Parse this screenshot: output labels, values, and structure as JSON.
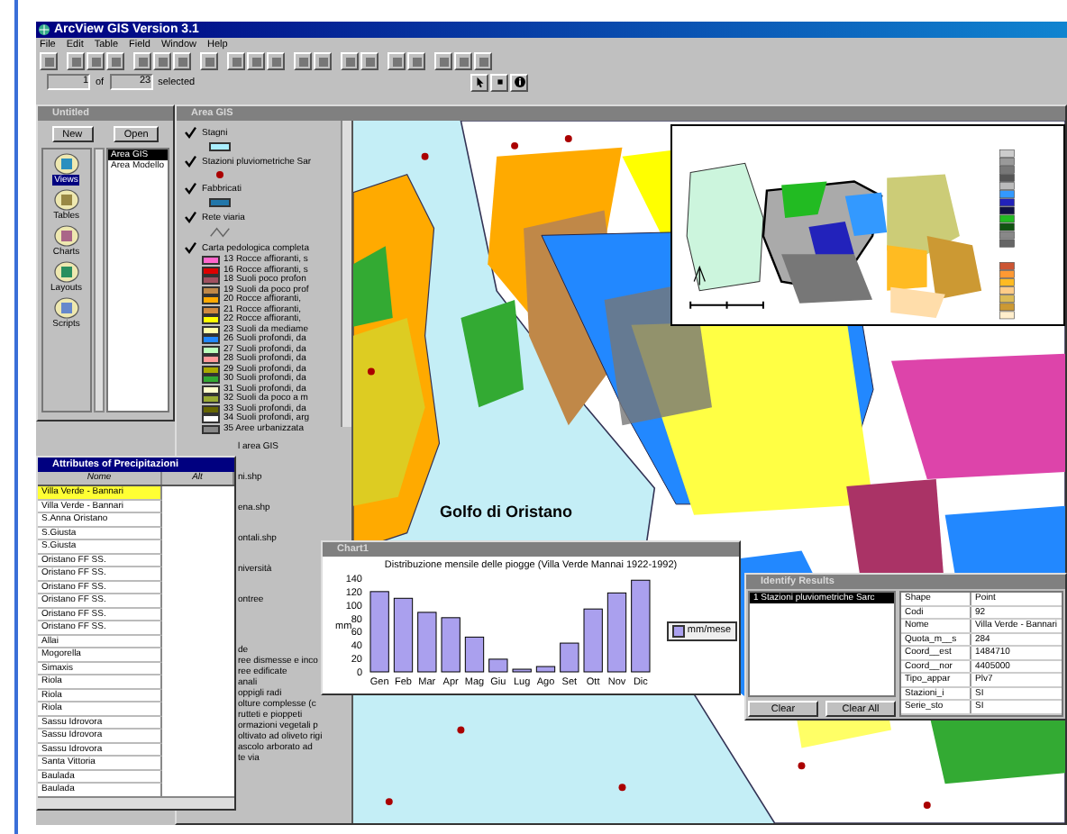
{
  "window": {
    "title": "ArcView GIS Version 3.1"
  },
  "menu": [
    "File",
    "Edit",
    "Table",
    "Field",
    "Window",
    "Help"
  ],
  "status": {
    "record": "1",
    "of_label": "of",
    "selected_count": "23",
    "selected_label": "selected"
  },
  "project_window": {
    "title": "Untitled",
    "active": false,
    "buttons": [
      "New",
      "Open"
    ],
    "doc_types": [
      {
        "label": "Views",
        "selected": true
      },
      {
        "label": "Tables",
        "selected": false
      },
      {
        "label": "Charts",
        "selected": false
      },
      {
        "label": "Layouts",
        "selected": false
      },
      {
        "label": "Scripts",
        "selected": false
      }
    ],
    "documents": [
      {
        "label": "Area GIS",
        "selected": true
      },
      {
        "label": "Area Modello",
        "selected": false
      }
    ]
  },
  "view_window": {
    "title": "Area GIS",
    "active": false,
    "layers": [
      {
        "name": "Stagni",
        "checked": true,
        "kind": "fill",
        "color": "#aaeeff"
      },
      {
        "name": "Stazioni pluviometriche Sar",
        "checked": true,
        "kind": "point",
        "color": "#aa0000"
      },
      {
        "name": "Fabbricati",
        "checked": true,
        "kind": "fill",
        "color": "#2277aa"
      },
      {
        "name": "Rete viaria",
        "checked": true,
        "kind": "line"
      },
      {
        "name": "Carta pedologica completa",
        "checked": true,
        "kind": "classes"
      }
    ],
    "classes": [
      {
        "label": "13 Rocce affioranti, s",
        "color": "#ff66cc"
      },
      {
        "label": "16 Rocce affioranti, s",
        "color": "#dd0000"
      },
      {
        "label": "18 Suoli poco profon",
        "color": "#a05060"
      },
      {
        "label": "19 Suoli da poco prof",
        "color": "#c08848"
      },
      {
        "label": "20 Rocce affioranti,",
        "color": "#ffaa00"
      },
      {
        "label": "21 Rocce affioranti,",
        "color": "#d08a40"
      },
      {
        "label": "22 Rocce affioranti,",
        "color": "#ffff00"
      },
      {
        "label": "23 Suoli da mediame",
        "color": "#ffffaa"
      },
      {
        "label": "26 Suoli profondi, da",
        "color": "#2288ff"
      },
      {
        "label": "27 Suoli profondi, da",
        "color": "#bbffbb"
      },
      {
        "label": "28 Suoli profondi, da",
        "color": "#ff9999"
      },
      {
        "label": "29 Suoli profondi, da",
        "color": "#aaaa00"
      },
      {
        "label": "30 Suoli profondi, da",
        "color": "#33aa33"
      },
      {
        "label": "31 Suoli profondi, da",
        "color": "#ffffcc"
      },
      {
        "label": "32 Suoli da poco a m",
        "color": "#99aa33"
      },
      {
        "label": "33 Suoli profondi, da",
        "color": "#666600"
      },
      {
        "label": "34 Suoli profondi, arg",
        "color": "#ffffff"
      },
      {
        "label": "35 Aree urbanizzata",
        "color": "#888888"
      }
    ],
    "partial_layers": [
      "l area GIS",
      "ni.shp",
      "ena.shp",
      "ontali.shp",
      "niversità",
      "ontree"
    ],
    "partial_classes": [
      "de",
      "ree dismesse e inco",
      "ree edificate",
      "anali",
      "oppigli radi",
      "olture complesse (c",
      "rutteti e pioppeti",
      "ormazioni vegetali p",
      "oltivato ad oliveto rigi",
      "ascolo arborato ad",
      "te via"
    ],
    "map_label": "Golfo di Oristano"
  },
  "attributes_window": {
    "title": "Attributes of Precipitazioni",
    "active": true,
    "columns": [
      "Nome",
      "Alt"
    ],
    "rows": [
      {
        "name": "Villa Verde - Bannari",
        "selected": true
      },
      {
        "name": "Villa Verde - Bannari",
        "selected": false
      },
      {
        "name": "S.Anna Oristano",
        "selected": false
      },
      {
        "name": "S.Giusta",
        "selected": false
      },
      {
        "name": "S.Giusta",
        "selected": false
      },
      {
        "name": "Oristano FF SS.",
        "selected": false
      },
      {
        "name": "Oristano FF SS.",
        "selected": false
      },
      {
        "name": "Oristano FF SS.",
        "selected": false
      },
      {
        "name": "Oristano FF SS.",
        "selected": false
      },
      {
        "name": "Oristano FF SS.",
        "selected": false
      },
      {
        "name": "Oristano FF SS.",
        "selected": false
      },
      {
        "name": "Allai",
        "selected": false
      },
      {
        "name": "Mogorella",
        "selected": false
      },
      {
        "name": "Simaxis",
        "selected": false
      },
      {
        "name": "Riola",
        "selected": false
      },
      {
        "name": "Riola",
        "selected": false
      },
      {
        "name": "Riola",
        "selected": false
      },
      {
        "name": "Sassu Idrovora",
        "selected": false
      },
      {
        "name": "Sassu Idrovora",
        "selected": false
      },
      {
        "name": "Sassu Idrovora",
        "selected": false
      },
      {
        "name": "Santa Vittoria",
        "selected": false
      },
      {
        "name": "Baulada",
        "selected": false
      },
      {
        "name": "Baulada",
        "selected": false
      }
    ]
  },
  "chart_window": {
    "title": "Chart1",
    "active": false,
    "chart_data": {
      "type": "bar",
      "title": "Distribuzione mensile delle piogge (Villa Verde Mannai 1922-1992)",
      "ylabel": "mm",
      "categories": [
        "Gen",
        "Feb",
        "Mar",
        "Apr",
        "Mag",
        "Giu",
        "Lug",
        "Ago",
        "Set",
        "Ott",
        "Nov",
        "Dic"
      ],
      "series": [
        {
          "name": "mm/mese",
          "color": "#aaa0ee",
          "values": [
            120,
            110,
            89,
            81,
            52,
            19,
            4,
            8,
            43,
            94,
            118,
            137
          ]
        }
      ],
      "ylim": [
        0,
        140
      ],
      "yticks": [
        0,
        20,
        40,
        60,
        80,
        100,
        120,
        140
      ]
    }
  },
  "identify_window": {
    "title": "Identify Results",
    "active": false,
    "results": [
      {
        "label": "1  Stazioni pluviometriche Sarc",
        "selected": true
      }
    ],
    "buttons": [
      "Clear",
      "Clear All"
    ],
    "fields": [
      {
        "field": "Shape",
        "value": "Point"
      },
      {
        "field": "Codi",
        "value": "92"
      },
      {
        "field": "Nome",
        "value": "Villa Verde - Bannari"
      },
      {
        "field": "Quota_m__s",
        "value": "284"
      },
      {
        "field": "Coord__est",
        "value": "1484710"
      },
      {
        "field": "Coord__nor",
        "value": "4405000"
      },
      {
        "field": "Tipo_appar",
        "value": "Plv7"
      },
      {
        "field": "Stazioni_i",
        "value": "SI"
      },
      {
        "field": "Serie_sto",
        "value": "SI"
      }
    ]
  }
}
